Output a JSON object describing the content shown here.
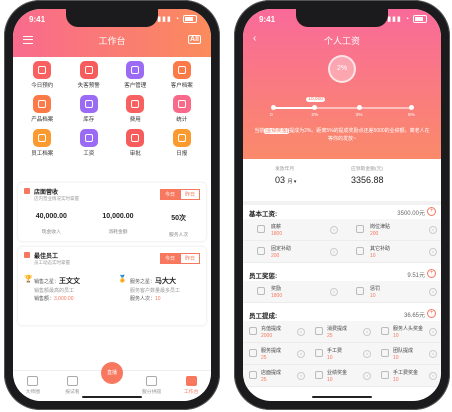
{
  "left": {
    "status_time": "9:41",
    "title": "工作台",
    "all_label": "All",
    "grid": [
      {
        "label": "今日预约",
        "color": "#f96060",
        "icon": "calendar-icon"
      },
      {
        "label": "失客预警",
        "color": "#f75c5c",
        "icon": "alarm-icon"
      },
      {
        "label": "客户管理",
        "color": "#9b6bf5",
        "icon": "user-icon"
      },
      {
        "label": "客户档案",
        "color": "#fb7a48",
        "icon": "folder-icon"
      },
      {
        "label": "产品档案",
        "color": "#fb7a48",
        "icon": "box-icon"
      },
      {
        "label": "库存",
        "color": "#9b6bf5",
        "icon": "stock-icon"
      },
      {
        "label": "费用",
        "color": "#f96060",
        "icon": "money-icon"
      },
      {
        "label": "统计",
        "color": "#f96a8a",
        "icon": "chart-icon"
      },
      {
        "label": "员工档案",
        "color": "#fb9a2e",
        "icon": "staff-icon"
      },
      {
        "label": "工资",
        "color": "#9b6bf5",
        "icon": "wage-icon"
      },
      {
        "label": "审批",
        "color": "#f75c5c",
        "icon": "approve-icon"
      },
      {
        "label": "日报",
        "color": "#fb9a2e",
        "icon": "report-icon"
      }
    ],
    "store": {
      "title": "店面营收",
      "sub": "店内营业情况实时掌握",
      "seg_today": "今日",
      "seg_yesterday": "昨日",
      "stats": [
        {
          "value": "40,000.00",
          "label": "现金收入"
        },
        {
          "value": "10,000.00",
          "label": "消耗金额"
        },
        {
          "value": "50次",
          "label": "服务人次"
        }
      ]
    },
    "staff": {
      "title": "最佳员工",
      "sub": "员工动态实时掌握",
      "seg_today": "今日",
      "seg_yesterday": "昨日",
      "sales_label": "销售之星：",
      "sales_name": "王文文",
      "sales_desc": "销售额最高的员工",
      "sales_amount_label": "销售额：",
      "sales_amount": "3,000.00",
      "service_label": "服务之星：",
      "service_name": "马大大",
      "service_desc": "服务客户数量最多员工",
      "service_count_label": "服务人次：",
      "service_count": "10"
    },
    "tabs": [
      {
        "label": "大师圈"
      },
      {
        "label": "报试看"
      },
      {
        "label": "直播"
      },
      {
        "label": "服分拼圆"
      },
      {
        "label": "工作台"
      }
    ]
  },
  "right": {
    "status_time": "9:41",
    "title": "个人工资",
    "badge": "2%",
    "bubble": "10,000",
    "ticks": [
      "0",
      "2%",
      "3%",
      "5%"
    ],
    "progress": 0.3,
    "tip_prefix": "当前",
    "tip_tag": "[业绩奖金]",
    "tip_text": "提成为2%。距离5%的提成奖励点还差5000的业绩额，离老人在等你的发放~",
    "period_label": "发放年月",
    "period_value": "03",
    "period_unit": "月",
    "total_label": "应领取金额(元)",
    "total_value": "3356.88",
    "base": {
      "title": "基本工资:",
      "amount": "3500.00元",
      "items": [
        {
          "name": "底薪",
          "value": "1800"
        },
        {
          "name": "岗位津贴",
          "value": "200"
        },
        {
          "name": "固定补助",
          "value": "200"
        },
        {
          "name": "其它补助",
          "value": "10"
        }
      ]
    },
    "bonus": {
      "title": "员工奖惩:",
      "amount": "9.51元",
      "items": [
        {
          "name": "奖励",
          "value": "1800"
        },
        {
          "name": "惩罚",
          "value": "10"
        }
      ]
    },
    "commission": {
      "title": "员工提成:",
      "amount": "36.65元",
      "items": [
        {
          "name": "充值提成",
          "value": "2000"
        },
        {
          "name": "消费提成",
          "value": "25"
        },
        {
          "name": "服务人头奖金",
          "value": "10"
        },
        {
          "name": "服务提成",
          "value": "25"
        },
        {
          "name": "手工费",
          "value": "10"
        },
        {
          "name": "团队提成",
          "value": "10"
        },
        {
          "name": "店面提成",
          "value": "25"
        },
        {
          "name": "业绩奖金",
          "value": "10"
        },
        {
          "name": "手工费奖金",
          "value": "10"
        }
      ]
    }
  }
}
